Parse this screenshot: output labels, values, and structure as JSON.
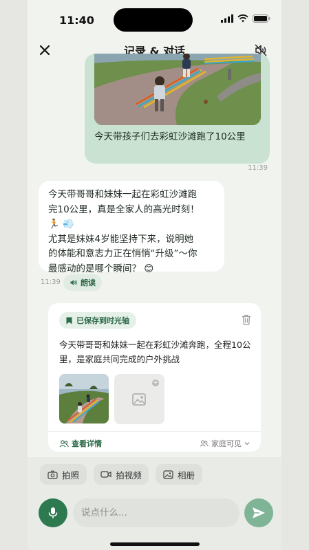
{
  "status_bar": {
    "time": "11:40"
  },
  "header": {
    "title": "记录 & 对话"
  },
  "user_message": {
    "text": "今天带孩子们去彩虹沙滩跑了10公里",
    "time": "11:39"
  },
  "assistant_message": {
    "lines": [
      "今天带哥哥和妹妹一起在彩虹沙滩跑",
      "完10公里，真是全家人的高光时刻！",
      "🏃 💨",
      "尤其是妹妹4岁能坚持下来，说明她",
      "的体能和意志力正在悄悄“升级”～你",
      "最感动的是哪个瞬间？ 😊"
    ],
    "time": "11:39",
    "read_label": "朗读"
  },
  "timeline_card": {
    "badge": "已保存到时光轴",
    "text": "今天带哥哥和妹妹一起在彩虹沙滩奔跑，全程10公里，是家庭共同完成的户外挑战",
    "detail_label": "查看详情",
    "visibility": "家庭可见"
  },
  "quick_actions": {
    "photo": "拍照",
    "video": "拍视频",
    "album": "相册"
  },
  "composer": {
    "placeholder": "说点什么..."
  },
  "colors": {
    "accent": "#2e7a50",
    "user_bubble": "#c9e2d2",
    "send_button": "#7fb596"
  }
}
